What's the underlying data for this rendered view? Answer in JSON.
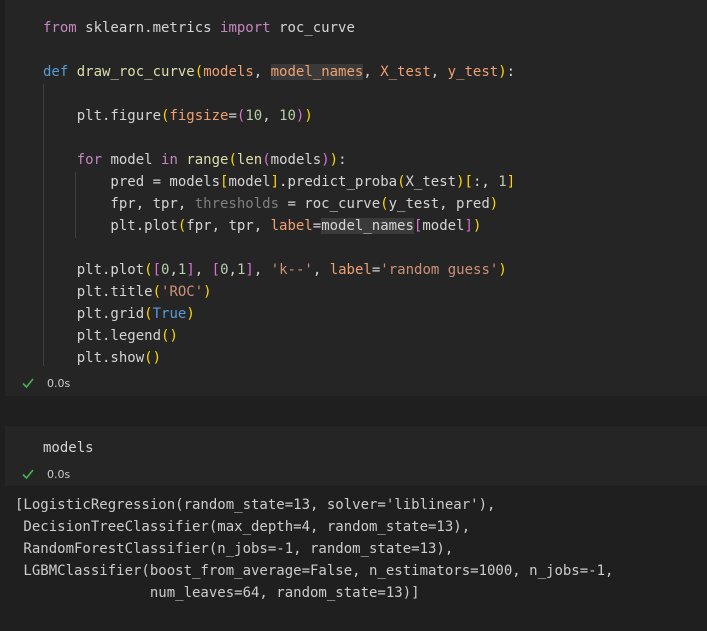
{
  "cells": [
    {
      "type": "code",
      "lines": [
        [
          {
            "t": "kw",
            "v": "from"
          },
          {
            "t": "id",
            "v": " sklearn.metrics "
          },
          {
            "t": "kw",
            "v": "import"
          },
          {
            "t": "id",
            "v": " roc_curve"
          }
        ],
        [],
        [
          {
            "t": "def",
            "v": "def"
          },
          {
            "t": "id",
            "v": " "
          },
          {
            "t": "fn",
            "v": "draw_roc_curve"
          },
          {
            "t": "b1",
            "v": "("
          },
          {
            "t": "param",
            "v": "models"
          },
          {
            "t": "op",
            "v": ", "
          },
          {
            "t": "param",
            "v": "model_names",
            "hl": true
          },
          {
            "t": "op",
            "v": ", "
          },
          {
            "t": "param",
            "v": "X_test"
          },
          {
            "t": "op",
            "v": ", "
          },
          {
            "t": "param",
            "v": "y_test"
          },
          {
            "t": "b1",
            "v": ")"
          },
          {
            "t": "op",
            "v": ":"
          }
        ],
        [],
        [
          {
            "t": "id",
            "v": "    plt.figure"
          },
          {
            "t": "b1",
            "v": "("
          },
          {
            "t": "param",
            "v": "figsize"
          },
          {
            "t": "op",
            "v": "="
          },
          {
            "t": "b2",
            "v": "("
          },
          {
            "t": "num",
            "v": "10"
          },
          {
            "t": "op",
            "v": ", "
          },
          {
            "t": "num",
            "v": "10"
          },
          {
            "t": "b2",
            "v": ")"
          },
          {
            "t": "b1",
            "v": ")"
          }
        ],
        [],
        [
          {
            "t": "id",
            "v": "    "
          },
          {
            "t": "kw",
            "v": "for"
          },
          {
            "t": "id",
            "v": " model "
          },
          {
            "t": "kw",
            "v": "in"
          },
          {
            "t": "id",
            "v": " "
          },
          {
            "t": "fn",
            "v": "range"
          },
          {
            "t": "b1",
            "v": "("
          },
          {
            "t": "fn",
            "v": "len"
          },
          {
            "t": "b2",
            "v": "("
          },
          {
            "t": "id",
            "v": "models"
          },
          {
            "t": "b2",
            "v": ")"
          },
          {
            "t": "b1",
            "v": ")"
          },
          {
            "t": "op",
            "v": ":"
          }
        ],
        [
          {
            "t": "id",
            "v": "        pred = models"
          },
          {
            "t": "b1",
            "v": "["
          },
          {
            "t": "id",
            "v": "model"
          },
          {
            "t": "b1",
            "v": "]"
          },
          {
            "t": "id",
            "v": ".predict_proba"
          },
          {
            "t": "b1",
            "v": "("
          },
          {
            "t": "id",
            "v": "X_test"
          },
          {
            "t": "b1",
            "v": ")"
          },
          {
            "t": "b1",
            "v": "["
          },
          {
            "t": "id",
            "v": ":, "
          },
          {
            "t": "num",
            "v": "1"
          },
          {
            "t": "b1",
            "v": "]"
          }
        ],
        [
          {
            "t": "id",
            "v": "        fpr, tpr, "
          },
          {
            "t": "dim",
            "v": "thresholds"
          },
          {
            "t": "id",
            "v": " = roc_curve"
          },
          {
            "t": "b1",
            "v": "("
          },
          {
            "t": "id",
            "v": "y_test, pred"
          },
          {
            "t": "b1",
            "v": ")"
          }
        ],
        [
          {
            "t": "id",
            "v": "        plt.plot"
          },
          {
            "t": "b1",
            "v": "("
          },
          {
            "t": "id",
            "v": "fpr, tpr, "
          },
          {
            "t": "param",
            "v": "label"
          },
          {
            "t": "op",
            "v": "="
          },
          {
            "t": "id",
            "v": "model_names",
            "hl": true
          },
          {
            "t": "b2",
            "v": "["
          },
          {
            "t": "id",
            "v": "model"
          },
          {
            "t": "b2",
            "v": "]"
          },
          {
            "t": "b1",
            "v": ")"
          }
        ],
        [],
        [
          {
            "t": "id",
            "v": "    plt.plot"
          },
          {
            "t": "b1",
            "v": "("
          },
          {
            "t": "b2",
            "v": "["
          },
          {
            "t": "num",
            "v": "0"
          },
          {
            "t": "op",
            "v": ","
          },
          {
            "t": "num",
            "v": "1"
          },
          {
            "t": "b2",
            "v": "]"
          },
          {
            "t": "op",
            "v": ", "
          },
          {
            "t": "b2",
            "v": "["
          },
          {
            "t": "num",
            "v": "0"
          },
          {
            "t": "op",
            "v": ","
          },
          {
            "t": "num",
            "v": "1"
          },
          {
            "t": "b2",
            "v": "]"
          },
          {
            "t": "op",
            "v": ", "
          },
          {
            "t": "str",
            "v": "'k--'"
          },
          {
            "t": "op",
            "v": ", "
          },
          {
            "t": "param",
            "v": "label"
          },
          {
            "t": "op",
            "v": "="
          },
          {
            "t": "str",
            "v": "'random guess'"
          },
          {
            "t": "b1",
            "v": ")"
          }
        ],
        [
          {
            "t": "id",
            "v": "    plt.title"
          },
          {
            "t": "b1",
            "v": "("
          },
          {
            "t": "str",
            "v": "'ROC'"
          },
          {
            "t": "b1",
            "v": ")"
          }
        ],
        [
          {
            "t": "id",
            "v": "    plt.grid"
          },
          {
            "t": "b1",
            "v": "("
          },
          {
            "t": "def",
            "v": "True"
          },
          {
            "t": "b1",
            "v": ")"
          }
        ],
        [
          {
            "t": "id",
            "v": "    plt.legend"
          },
          {
            "t": "b1",
            "v": "()"
          }
        ],
        [
          {
            "t": "id",
            "v": "    plt.show"
          },
          {
            "t": "b1",
            "v": "()"
          }
        ]
      ],
      "status_icon": "check-icon",
      "exec_time": "0.0s"
    },
    {
      "type": "code",
      "lines": [
        [
          {
            "t": "id",
            "v": "models"
          }
        ]
      ],
      "status_icon": "check-icon",
      "exec_time": "0.0s"
    }
  ],
  "output": {
    "lines": [
      "[LogisticRegression(random_state=13, solver='liblinear'),",
      " DecisionTreeClassifier(max_depth=4, random_state=13),",
      " RandomForestClassifier(n_jobs=-1, random_state=13),",
      " LGBMClassifier(boost_from_average=False, n_estimators=1000, n_jobs=-1,",
      "                num_leaves=64, random_state=13)]"
    ]
  },
  "colors": {
    "success": "#4caf50"
  }
}
